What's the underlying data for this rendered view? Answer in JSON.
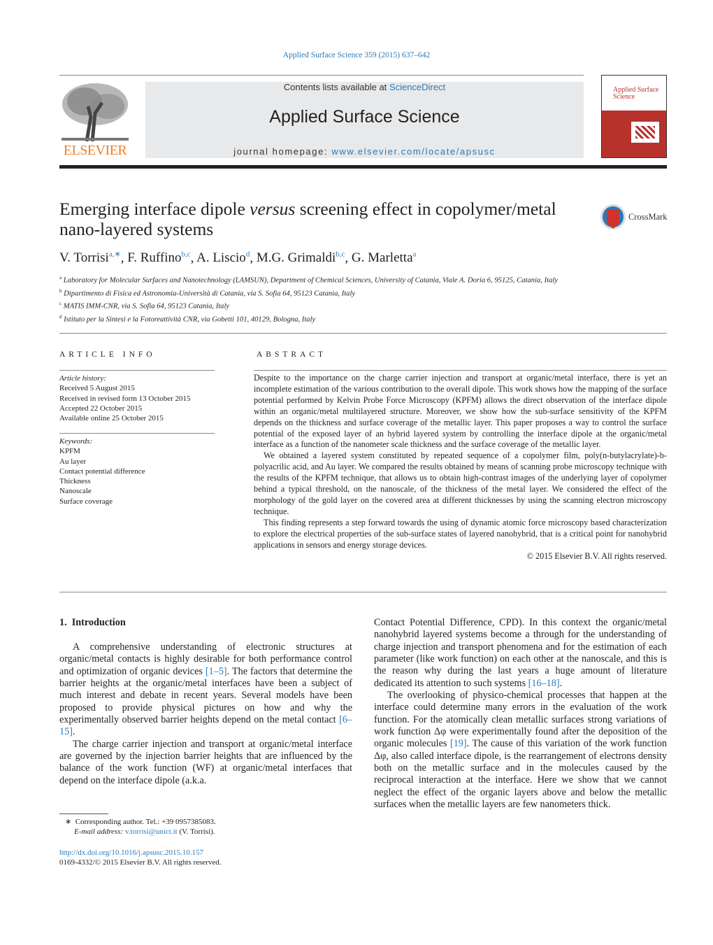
{
  "header": {
    "journal_ref": "Applied Surface Science 359 (2015) 637–642",
    "contents_prefix": "Contents lists available at ",
    "contents_link": "ScienceDirect",
    "journal_title": "Applied Surface Science",
    "homepage_prefix": "journal homepage: ",
    "homepage_link": "www.elsevier.com/locate/apsusc",
    "publisher_logo": "ELSEVIER",
    "cover_title": "Applied Surface Science",
    "colors": {
      "link": "#2a7ab8",
      "elsevier_orange": "#f07e26",
      "cover_red": "#b8322c",
      "band": "#e8e9ea"
    }
  },
  "article": {
    "title_a": "Emerging interface dipole ",
    "title_italic": "versus",
    "title_b": " screening effect in copolymer/metal nano-layered systems",
    "crossmark": "CrossMark",
    "authors": [
      {
        "name": "V. Torrisi",
        "sup": "a,∗"
      },
      {
        "name": "F. Ruffino",
        "sup": "b,c"
      },
      {
        "name": "A. Liscio",
        "sup": "d"
      },
      {
        "name": "M.G. Grimaldi",
        "sup": "b,c"
      },
      {
        "name": "G. Marletta",
        "sup": "a"
      }
    ],
    "affiliations": [
      {
        "key": "a",
        "text": "Laboratory for Molecular Surfaces and Nanotechnology (LAMSUN), Department of Chemical Sciences, University of Catania, Viale A. Doria 6, 95125, Catania, Italy"
      },
      {
        "key": "b",
        "text": "Dipartimento di Fisica ed Astronomia-Università di Catania, via S. Sofia 64, 95123 Catania, Italy"
      },
      {
        "key": "c",
        "text": "MATIS IMM-CNR, via S. Sofia 64, 95123 Catania, Italy"
      },
      {
        "key": "d",
        "text": "Istituto per la Sintesi e la Fotoreattività CNR, via Gobetti 101, 40129, Bologna, Italy"
      }
    ]
  },
  "info": {
    "heading": "ARTICLE INFO",
    "history_label": "Article history:",
    "history": [
      "Received 5 August 2015",
      "Received in revised form 13 October 2015",
      "Accepted 22 October 2015",
      "Available online 25 October 2015"
    ],
    "keywords_label": "Keywords:",
    "keywords": [
      "KPFM",
      "Au layer",
      "Contact potential difference",
      "Thickness",
      "Nanoscale",
      "Surface coverage"
    ]
  },
  "abstract": {
    "heading": "ABSTRACT",
    "paragraphs": [
      "Despite to the importance on the charge carrier injection and transport at organic/metal interface, there is yet an incomplete estimation of the various contribution to the overall dipole. This work shows how the mapping of the surface potential performed by Kelvin Probe Force Microscopy (KPFM) allows the direct observation of the interface dipole within an organic/metal multilayered structure. Moreover, we show how the sub-surface sensitivity of the KPFM depends on the thickness and surface coverage of the metallic layer. This paper proposes a way to control the surface potential of the exposed layer of an hybrid layered system by controlling the interface dipole at the organic/metal interface as a function of the nanometer scale thickness and the surface coverage of the metallic layer.",
      "We obtained a layered system constituted by repeated sequence of a copolymer film, poly(n-butylacrylate)-b-polyacrilic acid, and Au layer. We compared the results obtained by means of scanning probe microscopy technique with the results of the KPFM technique, that allows us to obtain high-contrast images of the underlying layer of copolymer behind a typical threshold, on the nanoscale, of the thickness of the metal layer. We considered the effect of the morphology of the gold layer on the covered area at different thicknesses by using the scanning electron microscopy technique.",
      "This finding represents a step forward towards the using of dynamic atomic force microscopy based characterization to explore the electrical properties of the sub-surface states of layered nanohybrid, that is a critical point for nanohybrid applications in sensors and energy storage devices."
    ],
    "copyright": "© 2015 Elsevier B.V. All rights reserved."
  },
  "intro": {
    "heading": "1.  Introduction",
    "p1": [
      "A comprehensive understanding of electronic structures at organic/metal contacts is highly desirable for both performance control and optimization of organic devices ",
      "[1–5]",
      ". The factors that determine the barrier heights at the organic/metal interfaces have been a subject of much interest and debate in recent years. Several models have been proposed to provide physical pictures on how and why the experimentally observed barrier heights depend on the metal contact ",
      "[6–15]",
      "."
    ],
    "p2a": "The charge carrier injection and transport at organic/metal interface are governed by the injection barrier heights that are influenced by the balance of the work function (WF) at organic/metal interfaces that depend on the interface dipole (a.k.a.",
    "p2b": [
      "Contact Potential Difference, CPD). In this context the organic/metal nanohybrid layered systems become a through for the understanding of charge injection and transport phenomena and for the estimation of each parameter (like work function) on each other at the nanoscale, and this is the reason why during the last years a huge amount of literature dedicated its attention to such systems ",
      "[16–18]",
      "."
    ],
    "p3": [
      "The overlooking of physico-chemical processes that happen at the interface could determine many errors in the evaluation of the work function. For the atomically clean metallic surfaces strong variations of work function Δφ were experimentally found after the deposition of the organic molecules ",
      "[19]",
      ". The cause of this variation of the work function Δφ, also called interface dipole, is the rearrangement of electrons density both on the metallic surface and in the molecules caused by the reciprocal interaction at the interface. Here we show that we cannot neglect the effect of the organic layers above and below the metallic surfaces when the metallic layers are few nanometers thick."
    ]
  },
  "footnote": {
    "star": "∗",
    "corresponding": "Corresponding author. Tel.: +39 0957385083.",
    "email_label": "E-mail address: ",
    "email": "v.torrisi@unict.it",
    "email_suffix": " (V. Torrisi)."
  },
  "footer": {
    "doi": "http://dx.doi.org/10.1016/j.apsusc.2015.10.157",
    "issn": "0169-4332/© 2015 Elsevier B.V. All rights reserved."
  }
}
